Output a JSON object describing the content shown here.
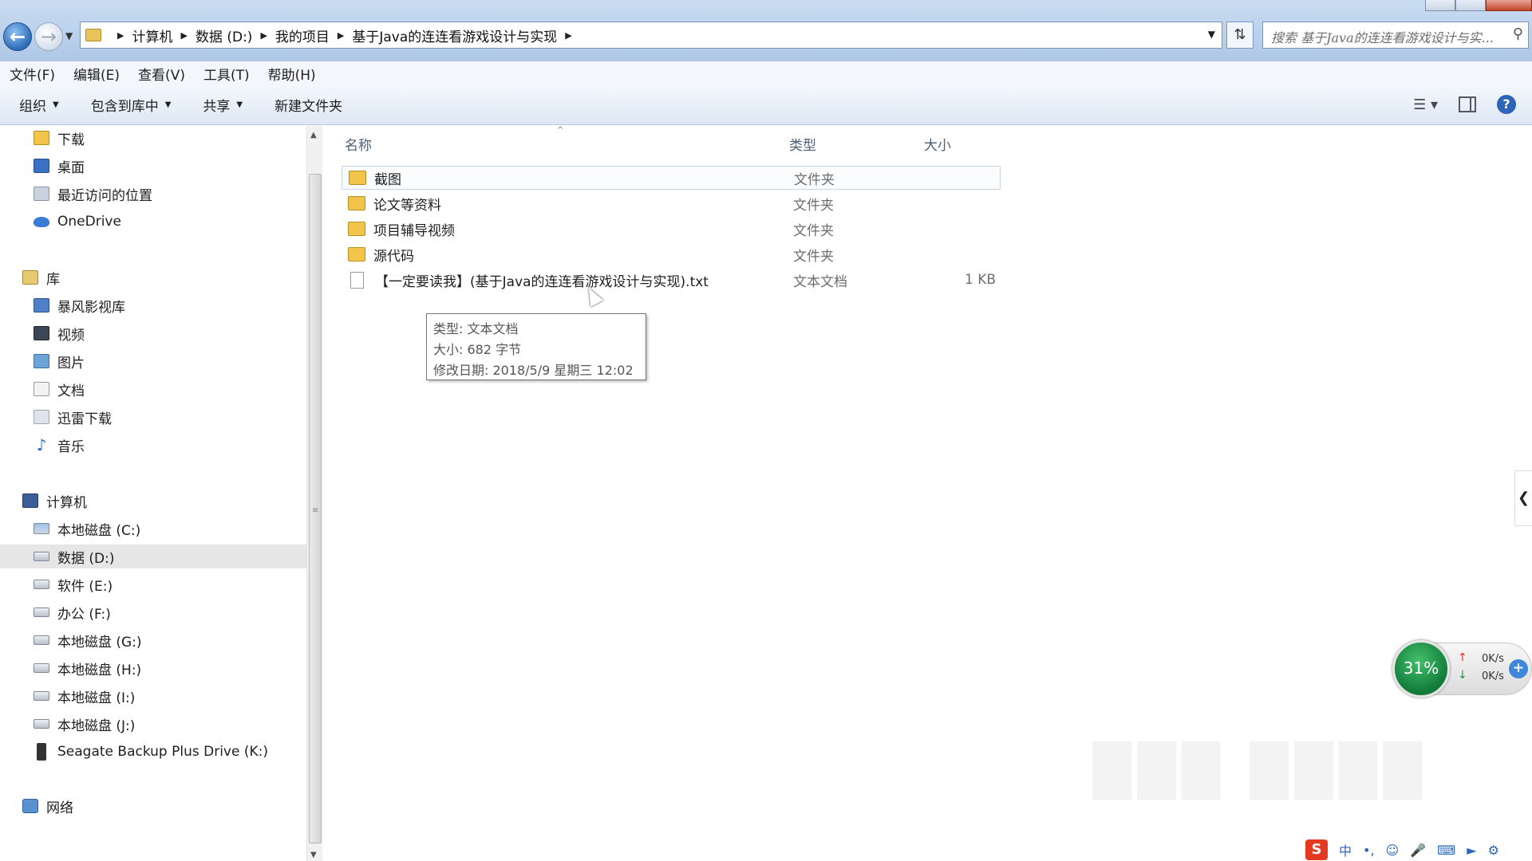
{
  "window": {
    "breadcrumb": [
      "计算机",
      "数据 (D:)",
      "我的项目",
      "基于Java的连连看游戏设计与实现"
    ],
    "search_placeholder": "搜索 基于Java的连连看游戏设计与实..."
  },
  "menu": [
    "文件(F)",
    "编辑(E)",
    "查看(V)",
    "工具(T)",
    "帮助(H)"
  ],
  "toolbar": {
    "organize": "组织",
    "include_library": "包含到库中",
    "share": "共享",
    "new_folder": "新建文件夹"
  },
  "nav": {
    "favorites": [
      {
        "label": "下载",
        "icon": "download-folder-icon"
      },
      {
        "label": "桌面",
        "icon": "desktop-icon"
      },
      {
        "label": "最近访问的位置",
        "icon": "recent-places-icon"
      },
      {
        "label": "OneDrive",
        "icon": "onedrive-icon"
      }
    ],
    "libraries_header": "库",
    "libraries": [
      {
        "label": "暴风影视库",
        "icon": "media-library-icon"
      },
      {
        "label": "视频",
        "icon": "video-library-icon"
      },
      {
        "label": "图片",
        "icon": "pictures-library-icon"
      },
      {
        "label": "文档",
        "icon": "documents-library-icon"
      },
      {
        "label": "迅雷下载",
        "icon": "thunder-download-icon"
      },
      {
        "label": "音乐",
        "icon": "music-library-icon"
      }
    ],
    "computer_header": "计算机",
    "drives": [
      {
        "label": "本地磁盘 (C:)",
        "icon": "system-drive-icon"
      },
      {
        "label": "数据 (D:)",
        "icon": "drive-icon",
        "selected": true
      },
      {
        "label": "软件 (E:)",
        "icon": "drive-icon"
      },
      {
        "label": "办公 (F:)",
        "icon": "drive-icon"
      },
      {
        "label": "本地磁盘 (G:)",
        "icon": "drive-icon"
      },
      {
        "label": "本地磁盘 (H:)",
        "icon": "drive-icon"
      },
      {
        "label": "本地磁盘 (I:)",
        "icon": "drive-icon"
      },
      {
        "label": "本地磁盘 (J:)",
        "icon": "drive-icon"
      },
      {
        "label": "Seagate Backup Plus Drive (K:)",
        "icon": "usb-drive-icon"
      }
    ],
    "network": "网络"
  },
  "columns": {
    "name": "名称",
    "type": "类型",
    "size": "大小"
  },
  "files": [
    {
      "name": "截图",
      "type": "文件夹",
      "size": "",
      "kind": "folder",
      "selected": true
    },
    {
      "name": "论文等资料",
      "type": "文件夹",
      "size": "",
      "kind": "folder"
    },
    {
      "name": "项目辅导视频",
      "type": "文件夹",
      "size": "",
      "kind": "folder"
    },
    {
      "name": "源代码",
      "type": "文件夹",
      "size": "",
      "kind": "folder"
    },
    {
      "name": "【一定要读我】(基于Java的连连看游戏设计与实现).txt",
      "type": "文本文档",
      "size": "1 KB",
      "kind": "txt"
    }
  ],
  "tooltip": {
    "type": "类型: 文本文档",
    "size": "大小: 682 字节",
    "modified": "修改日期: 2018/5/9 星期三 12:02"
  },
  "net_widget": {
    "percent": "31%",
    "up": "0K/s",
    "down": "0K/s"
  },
  "tray": {
    "ime": "中"
  }
}
